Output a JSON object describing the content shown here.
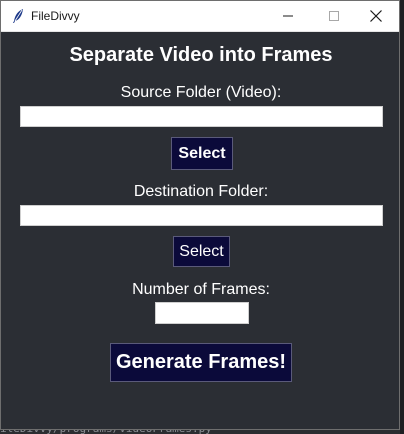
{
  "window": {
    "title": "FileDivvy",
    "app_icon": "feather-icon",
    "controls": [
      "minimize-icon",
      "maximize-icon",
      "close-icon"
    ]
  },
  "form": {
    "heading": "Separate Video into Frames",
    "source_label": "Source Folder (Video):",
    "source_value": "",
    "source_select_label": "Select",
    "destination_label": "Destination Folder:",
    "destination_value": "",
    "destination_select_label": "Select",
    "frames_label": "Number of Frames:",
    "frames_value": "",
    "generate_label": "Generate Frames!"
  },
  "background": {
    "bottom_text": "ileDivvy/programs/VideoFrames.py"
  },
  "colors": {
    "window_bg": "#2b2e34",
    "button_bg": "#0b0a3a",
    "text": "#ffffff"
  }
}
